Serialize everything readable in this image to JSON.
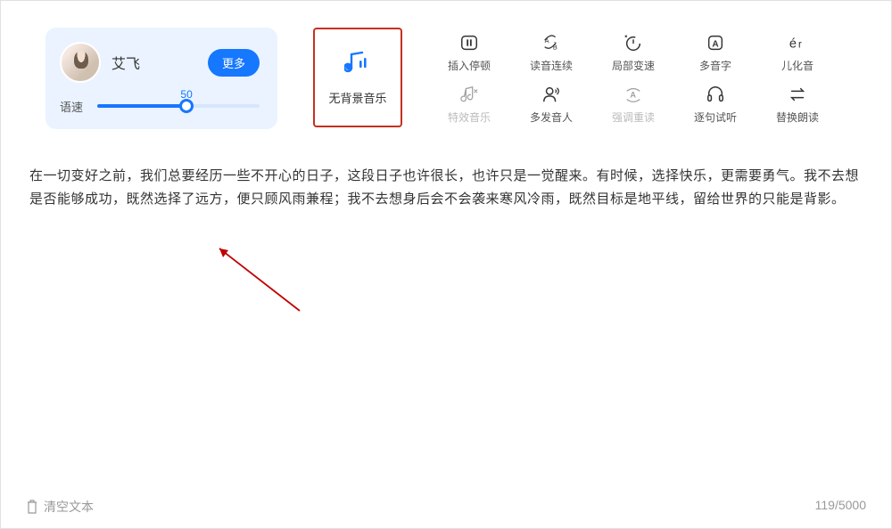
{
  "voice_panel": {
    "name": "艾飞",
    "more_btn": "更多",
    "speed_label": "语速",
    "speed_value": "50"
  },
  "bgm": {
    "label": "无背景音乐"
  },
  "tools": {
    "row1": [
      {
        "name": "insert-pause",
        "label": "插入停顿"
      },
      {
        "name": "read-continuous",
        "label": "读音连续"
      },
      {
        "name": "local-speed",
        "label": "局部变速"
      },
      {
        "name": "polyphone",
        "label": "多音字"
      },
      {
        "name": "erhua",
        "label": "儿化音"
      }
    ],
    "row2": [
      {
        "name": "sfx-music",
        "label": "特效音乐",
        "disabled": true
      },
      {
        "name": "multi-speaker",
        "label": "多发音人"
      },
      {
        "name": "emphasize",
        "label": "强调重读",
        "disabled": true
      },
      {
        "name": "sentence-preview",
        "label": "逐句试听"
      },
      {
        "name": "replace-read",
        "label": "替换朗读"
      }
    ]
  },
  "content_text": "在一切变好之前，我们总要经历一些不开心的日子，这段日子也许很长，也许只是一觉醒来。有时候，选择快乐，更需要勇气。我不去想是否能够成功，既然选择了远方，便只顾风雨兼程；我不去想身后会不会袭来寒风冷雨，既然目标是地平线，留给世界的只能是背影。",
  "footer": {
    "clear": "清空文本",
    "count": "119/5000"
  },
  "colors": {
    "primary": "#1677ff",
    "highlight_border": "#c53020"
  }
}
